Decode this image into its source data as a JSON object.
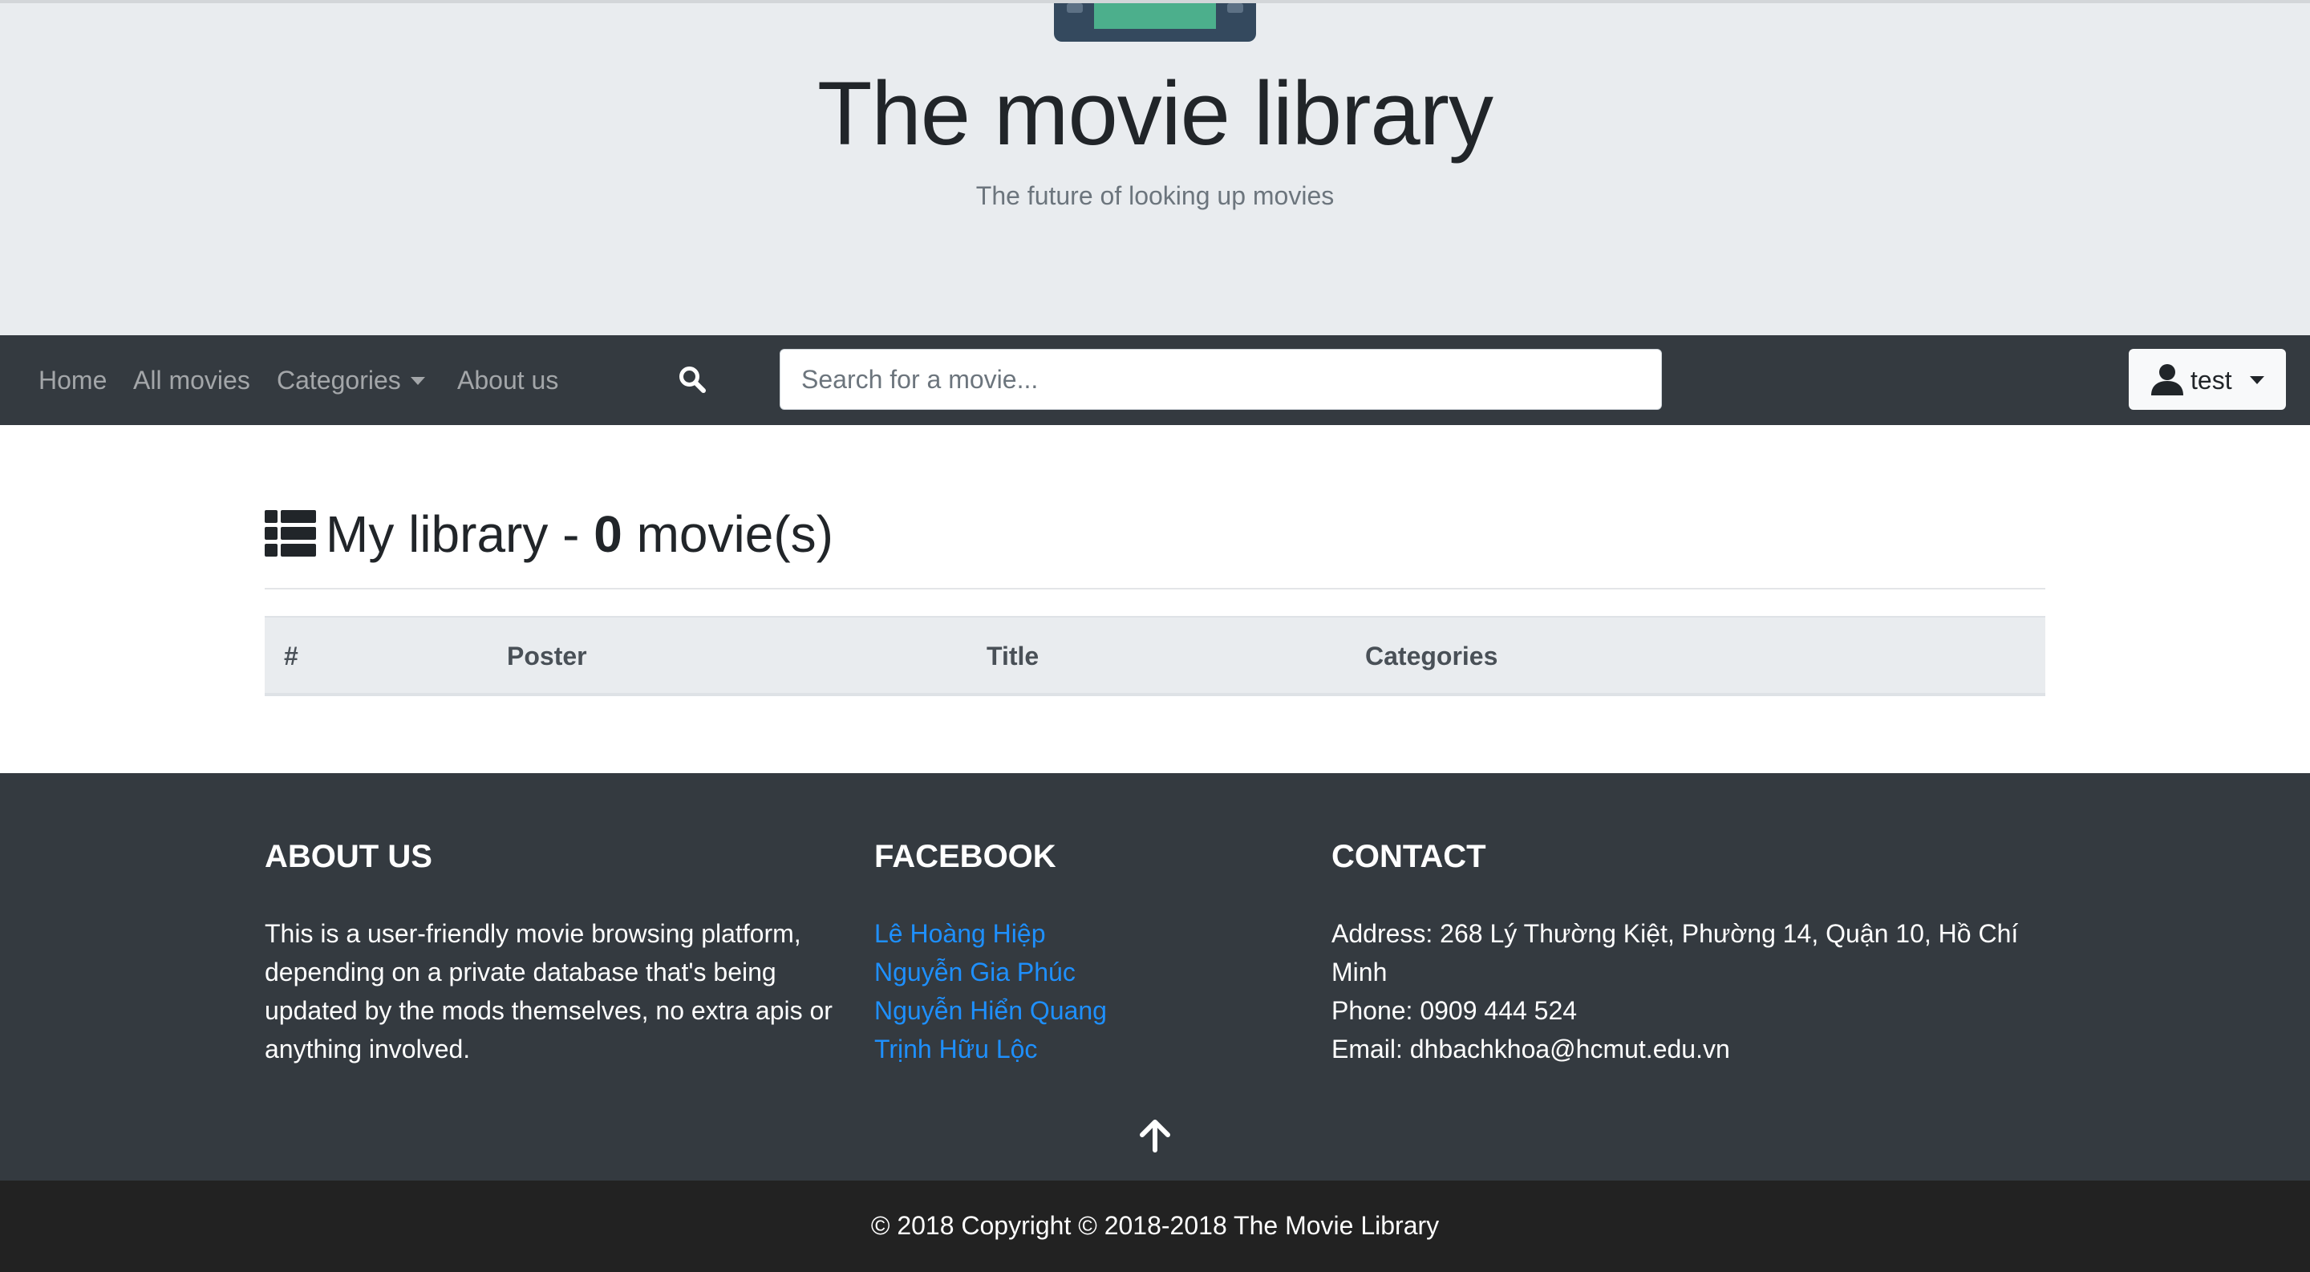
{
  "hero": {
    "title": "The movie library",
    "subtitle": "The future of looking up movies",
    "logo_icon": "film-logo-icon"
  },
  "navbar": {
    "items": [
      {
        "label": "Home"
      },
      {
        "label": "All movies"
      },
      {
        "label": "Categories"
      },
      {
        "label": "About us"
      }
    ],
    "search_icon": "search-icon",
    "search_placeholder": "Search for a movie...",
    "search_value": "",
    "user": {
      "icon": "user-icon",
      "label": "test"
    }
  },
  "library": {
    "icon": "list-icon",
    "heading_prefix": "My library - ",
    "count": "0",
    "heading_suffix": " movie(s)",
    "columns": [
      "#",
      "Poster",
      "Title",
      "Categories"
    ],
    "rows": []
  },
  "footer": {
    "about": {
      "heading": "ABOUT US",
      "text": "This is a user-friendly movie browsing platform, depending on a private database that's being updated by the mods themselves, no extra apis or anything involved."
    },
    "facebook": {
      "heading": "FACEBOOK",
      "links": [
        "Lê Hoàng Hiệp",
        "Nguyễn Gia Phúc",
        "Nguyễn Hiển Quang",
        "Trịnh Hữu Lộc"
      ]
    },
    "contact": {
      "heading": "CONTACT",
      "address": "Address: 268 Lý Thường Kiệt, Phường 14, Quận 10, Hồ Chí Minh",
      "phone": "Phone: 0909 444 524",
      "email": "Email: dhbachkhoa@hcmut.edu.vn"
    },
    "back_to_top_icon": "arrow-up-icon",
    "copyright": "© 2018 Copyright © 2018-2018 The Movie Library"
  },
  "colors": {
    "hero_bg": "#e9ecef",
    "navbar_bg": "#343a40",
    "footer_bg": "#343a40",
    "copyright_bg": "#222222",
    "link": "#1e90ff",
    "logo_green": "#4caf8c",
    "logo_dark": "#34495e"
  }
}
